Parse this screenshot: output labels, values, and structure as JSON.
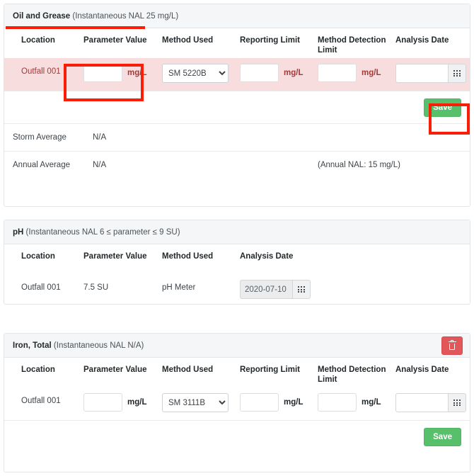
{
  "sections": [
    {
      "id": "oil-and-grease",
      "title_bold": "Oil and Grease",
      "title_note": " (Instantaneous NAL 25 mg/L)",
      "columns": [
        "Location",
        "Parameter Value",
        "Method Used",
        "Reporting Limit",
        "Method Detection Limit",
        "Analysis Date"
      ],
      "row": {
        "location": "Outfall 001",
        "parameter_value": "",
        "parameter_unit": "mg/L",
        "method_used": "SM 5220B",
        "method_options": [
          "SM 5220B"
        ],
        "reporting_limit": "",
        "reporting_unit": "mg/L",
        "mdl": "",
        "mdl_unit": "mg/L",
        "analysis_date": "",
        "analysis_date_placeholder": "",
        "calendar_icon": "calendar-grid-icon"
      },
      "save_label": "Save",
      "averages": [
        {
          "label": "Storm Average",
          "value": "N/A",
          "note": ""
        },
        {
          "label": "Annual Average",
          "value": "N/A",
          "note": "(Annual NAL: 15 mg/L)"
        }
      ]
    },
    {
      "id": "ph",
      "title_bold": "pH",
      "title_note": " (Instantaneous NAL 6 ≤ parameter ≤ 9 SU)",
      "columns": [
        "Location",
        "Parameter Value",
        "Method Used",
        "Analysis Date"
      ],
      "row": {
        "location": "Outfall 001",
        "parameter_value": "7.5 SU",
        "method_used": "pH Meter",
        "analysis_date": "2020-07-10",
        "calendar_icon": "calendar-grid-icon"
      }
    },
    {
      "id": "iron-total",
      "title_bold": "Iron, Total",
      "title_note": " (Instantaneous NAL N/A)",
      "delete_icon": "trash-icon",
      "columns": [
        "Location",
        "Parameter Value",
        "Method Used",
        "Reporting Limit",
        "Method Detection Limit",
        "Analysis Date"
      ],
      "row": {
        "location": "Outfall 001",
        "parameter_value": "",
        "parameter_unit": "mg/L",
        "method_used": "SM 3111B",
        "method_options": [
          "SM 3111B"
        ],
        "reporting_limit": "",
        "reporting_unit": "mg/L",
        "mdl": "",
        "mdl_unit": "mg/L",
        "analysis_date": "",
        "analysis_date_placeholder": "",
        "calendar_icon": "calendar-grid-icon"
      },
      "save_label": "Save"
    }
  ],
  "colors": {
    "accent_save": "#58c06a",
    "accent_delete": "#e2575a",
    "annotation": "#fa1e07",
    "row_highlight_bg": "#f7dddd",
    "row_highlight_text": "#a33a3a"
  },
  "annotations": [
    {
      "name": "title-underline"
    },
    {
      "name": "parameter-value-box"
    },
    {
      "name": "save-button-box"
    }
  ]
}
